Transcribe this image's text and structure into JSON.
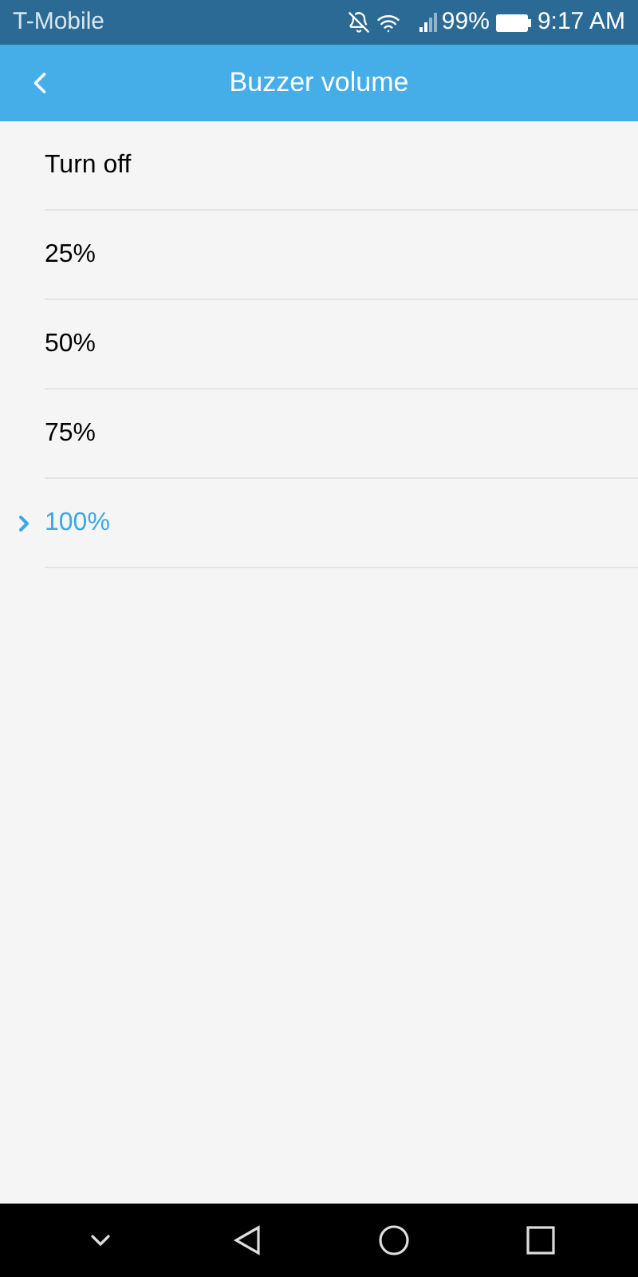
{
  "status_bar": {
    "carrier": "T-Mobile",
    "battery": "99%",
    "time": "9:17 AM"
  },
  "header": {
    "title": "Buzzer volume"
  },
  "options": [
    {
      "label": "Turn off",
      "selected": false
    },
    {
      "label": "25%",
      "selected": false
    },
    {
      "label": "50%",
      "selected": false
    },
    {
      "label": "75%",
      "selected": false
    },
    {
      "label": "100%",
      "selected": true
    }
  ]
}
